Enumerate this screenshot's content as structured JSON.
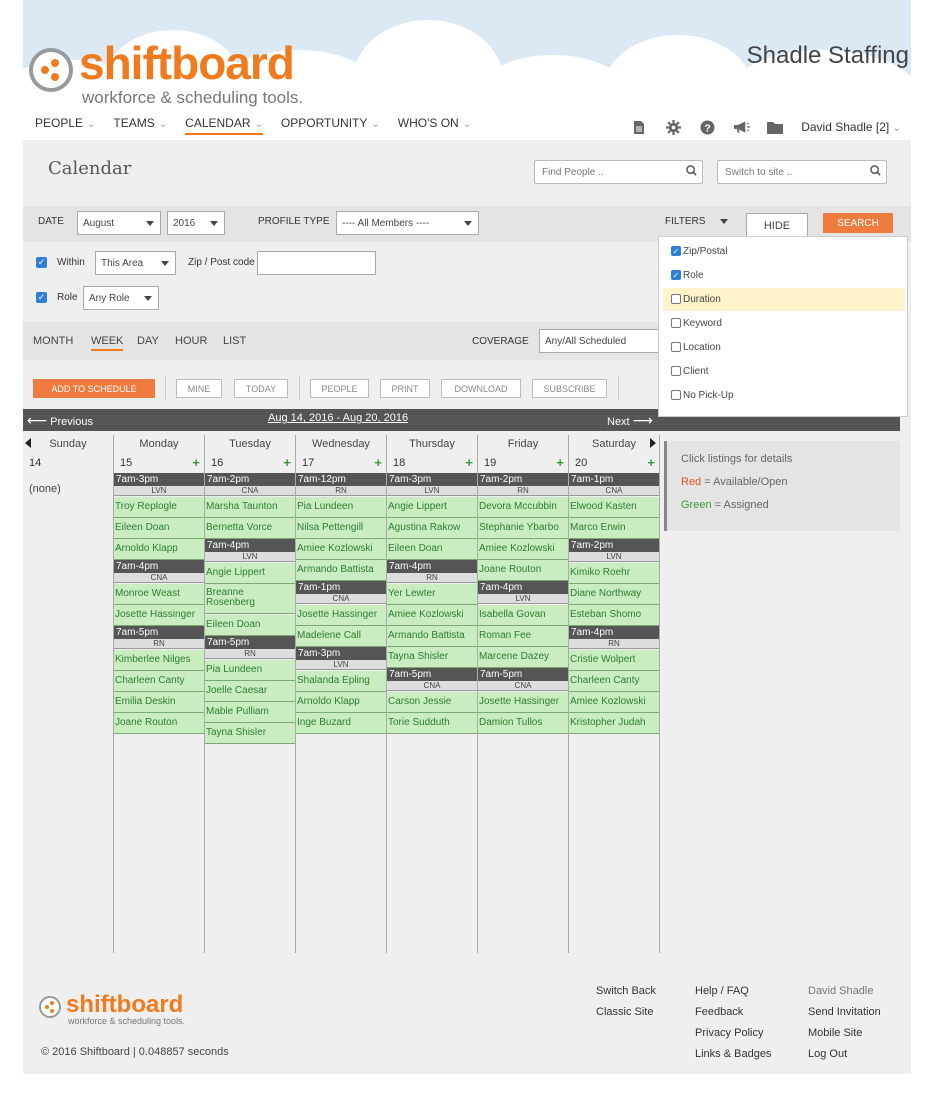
{
  "header": {
    "logo_word": "shiftboard",
    "logo_tagline": "workforce & scheduling tools.",
    "org_name": "Shadle Staffing",
    "nav": [
      "PEOPLE",
      "TEAMS",
      "CALENDAR",
      "OPPORTUNITY",
      "WHO'S ON"
    ],
    "active_nav": "CALENDAR",
    "icons": [
      "document-icon",
      "gear-icon",
      "help-icon",
      "megaphone-icon",
      "folder-icon"
    ],
    "user": "David Shadle [2]"
  },
  "page": {
    "title": "Calendar",
    "find_people_placeholder": "Find People ..",
    "switch_site_placeholder": "Switch to site .."
  },
  "filters": {
    "date_label": "DATE",
    "month": "August",
    "year": "2016",
    "profile_type_label": "PROFILE TYPE",
    "profile_type_value": "---- All Members ----",
    "filters_label": "FILTERS",
    "hide_label": "HIDE",
    "search_label": "SEARCH",
    "within_label": "Within",
    "within_value": "This Area",
    "zip_label": "Zip / Post code",
    "role_label": "Role",
    "role_value": "Any Role",
    "options": [
      {
        "label": "Zip/Postal",
        "checked": true
      },
      {
        "label": "Role",
        "checked": true
      },
      {
        "label": "Duration",
        "checked": false,
        "highlight": true
      },
      {
        "label": "Keyword",
        "checked": false
      },
      {
        "label": "Location",
        "checked": false
      },
      {
        "label": "Client",
        "checked": false
      },
      {
        "label": "No Pick-Up",
        "checked": false
      }
    ]
  },
  "views": {
    "tabs": [
      "MONTH",
      "WEEK",
      "DAY",
      "HOUR",
      "LIST"
    ],
    "active": "WEEK",
    "coverage_label": "COVERAGE",
    "coverage_value": "Any/All Scheduled"
  },
  "actions": {
    "add": "ADD TO SCHEDULE",
    "buttons": [
      "MINE",
      "TODAY",
      "PEOPLE",
      "PRINT",
      "DOWNLOAD",
      "SUBSCRIBE"
    ]
  },
  "week": {
    "prev": "Previous",
    "range": "Aug 14, 2016 - Aug 20, 2016",
    "next": "Next"
  },
  "legend": {
    "title": "Click listings for details",
    "red_word": "Red",
    "red_text": " = Available/Open",
    "green_word": "Green",
    "green_text": " = Assigned"
  },
  "colors": {
    "brand": "#f07b1f",
    "assigned": "#c9edc0",
    "assigned_text": "#2e7d32",
    "red": "#e0531f",
    "green": "#3a9a3a"
  },
  "calendar": {
    "days": [
      {
        "name": "Sunday",
        "num": "14",
        "none": "(none)",
        "items": []
      },
      {
        "name": "Monday",
        "num": "15",
        "items": [
          {
            "t": "h",
            "v": "7am-3pm"
          },
          {
            "t": "r",
            "v": "LVN"
          },
          {
            "t": "p",
            "v": "Troy Replogle"
          },
          {
            "t": "p",
            "v": "Eileen Doan"
          },
          {
            "t": "p",
            "v": "Arnoldo Klapp"
          },
          {
            "t": "h",
            "v": "7am-4pm"
          },
          {
            "t": "r",
            "v": "CNA"
          },
          {
            "t": "p",
            "v": "Monroe Weast"
          },
          {
            "t": "p",
            "v": "Josette Hassinger"
          },
          {
            "t": "h",
            "v": "7am-5pm"
          },
          {
            "t": "r",
            "v": "RN"
          },
          {
            "t": "p",
            "v": "Kimberlee Nilges"
          },
          {
            "t": "p",
            "v": "Charleen Canty"
          },
          {
            "t": "p",
            "v": "Emilia Deskin"
          },
          {
            "t": "p",
            "v": "Joane Routon"
          }
        ]
      },
      {
        "name": "Tuesday",
        "num": "16",
        "items": [
          {
            "t": "h",
            "v": "7am-2pm"
          },
          {
            "t": "r",
            "v": "CNA"
          },
          {
            "t": "p",
            "v": "Marsha Taunton"
          },
          {
            "t": "p",
            "v": "Bernetta Vorce"
          },
          {
            "t": "h",
            "v": "7am-4pm"
          },
          {
            "t": "r",
            "v": "LVN"
          },
          {
            "t": "p",
            "v": "Angie Lippert"
          },
          {
            "t": "pt",
            "v": "Breanne Rosenberg"
          },
          {
            "t": "p",
            "v": "Eileen Doan"
          },
          {
            "t": "h",
            "v": "7am-5pm"
          },
          {
            "t": "r",
            "v": "RN"
          },
          {
            "t": "p",
            "v": "Pia Lundeen"
          },
          {
            "t": "p",
            "v": "Joelle Caesar"
          },
          {
            "t": "p",
            "v": "Mable Pulliam"
          },
          {
            "t": "p",
            "v": "Tayna Shisler"
          }
        ]
      },
      {
        "name": "Wednesday",
        "num": "17",
        "items": [
          {
            "t": "h",
            "v": "7am-12pm"
          },
          {
            "t": "r",
            "v": "RN"
          },
          {
            "t": "p",
            "v": "Pia Lundeen"
          },
          {
            "t": "p",
            "v": "Nilsa Pettengill"
          },
          {
            "t": "p",
            "v": "Amiee Kozlowski"
          },
          {
            "t": "p",
            "v": "Armando Battista"
          },
          {
            "t": "h",
            "v": "7am-1pm"
          },
          {
            "t": "r",
            "v": "CNA"
          },
          {
            "t": "p",
            "v": "Josette Hassinger"
          },
          {
            "t": "p",
            "v": "Madelene Call"
          },
          {
            "t": "h",
            "v": "7am-3pm"
          },
          {
            "t": "r",
            "v": "LVN"
          },
          {
            "t": "p",
            "v": "Shalanda Epling"
          },
          {
            "t": "p",
            "v": "Arnoldo Klapp"
          },
          {
            "t": "p",
            "v": "Inge Buzard"
          }
        ]
      },
      {
        "name": "Thursday",
        "num": "18",
        "items": [
          {
            "t": "h",
            "v": "7am-3pm"
          },
          {
            "t": "r",
            "v": "LVN"
          },
          {
            "t": "p",
            "v": "Angie Lippert"
          },
          {
            "t": "p",
            "v": "Agustina Rakow"
          },
          {
            "t": "p",
            "v": "Eileen Doan"
          },
          {
            "t": "h",
            "v": "7am-4pm"
          },
          {
            "t": "r",
            "v": "RN"
          },
          {
            "t": "p",
            "v": "Yer Lewter"
          },
          {
            "t": "p",
            "v": "Amiee Kozlowski"
          },
          {
            "t": "p",
            "v": "Armando Battista"
          },
          {
            "t": "p",
            "v": "Tayna Shisler"
          },
          {
            "t": "h",
            "v": "7am-5pm"
          },
          {
            "t": "r",
            "v": "CNA"
          },
          {
            "t": "p",
            "v": "Carson Jessie"
          },
          {
            "t": "p",
            "v": "Torie Sudduth"
          }
        ]
      },
      {
        "name": "Friday",
        "num": "19",
        "items": [
          {
            "t": "h",
            "v": "7am-2pm"
          },
          {
            "t": "r",
            "v": "RN"
          },
          {
            "t": "p",
            "v": "Devora Mccubbin"
          },
          {
            "t": "p",
            "v": "Stephanie Ybarbo"
          },
          {
            "t": "p",
            "v": "Amiee Kozlowski"
          },
          {
            "t": "p",
            "v": "Joane Routon"
          },
          {
            "t": "h",
            "v": "7am-4pm"
          },
          {
            "t": "r",
            "v": "LVN"
          },
          {
            "t": "p",
            "v": "Isabella Govan"
          },
          {
            "t": "p",
            "v": "Roman Fee"
          },
          {
            "t": "p",
            "v": "Marcene Dazey"
          },
          {
            "t": "h",
            "v": "7am-5pm"
          },
          {
            "t": "r",
            "v": "CNA"
          },
          {
            "t": "p",
            "v": "Josette Hassinger"
          },
          {
            "t": "p",
            "v": "Damion Tullos"
          }
        ]
      },
      {
        "name": "Saturday",
        "num": "20",
        "items": [
          {
            "t": "h",
            "v": "7am-1pm"
          },
          {
            "t": "r",
            "v": "CNA"
          },
          {
            "t": "p",
            "v": "Elwood Kasten"
          },
          {
            "t": "p",
            "v": "Marco Erwin"
          },
          {
            "t": "h",
            "v": "7am-2pm"
          },
          {
            "t": "r",
            "v": "LVN"
          },
          {
            "t": "p",
            "v": "Kimiko Roehr"
          },
          {
            "t": "p",
            "v": "Diane Northway"
          },
          {
            "t": "p",
            "v": "Esteban Shomo"
          },
          {
            "t": "h",
            "v": "7am-4pm"
          },
          {
            "t": "r",
            "v": "RN"
          },
          {
            "t": "p",
            "v": "Cristie Wolpert"
          },
          {
            "t": "p",
            "v": "Charleen Canty"
          },
          {
            "t": "p",
            "v": "Amiee Kozlowski"
          },
          {
            "t": "p",
            "v": "Kristopher Judah"
          }
        ]
      }
    ]
  },
  "footer": {
    "logo_word": "shiftboard",
    "logo_tagline": "workforce & scheduling tools.",
    "copyright": "© 2016 Shiftboard |  0.048857 seconds",
    "col1": [
      "Switch Back",
      "Classic Site"
    ],
    "col2": [
      "Help / FAQ",
      "Feedback",
      "Privacy Policy",
      "Links & Badges"
    ],
    "col3_name": "David Shadle",
    "col3": [
      "Send Invitation",
      "Mobile Site",
      "Log Out"
    ]
  }
}
